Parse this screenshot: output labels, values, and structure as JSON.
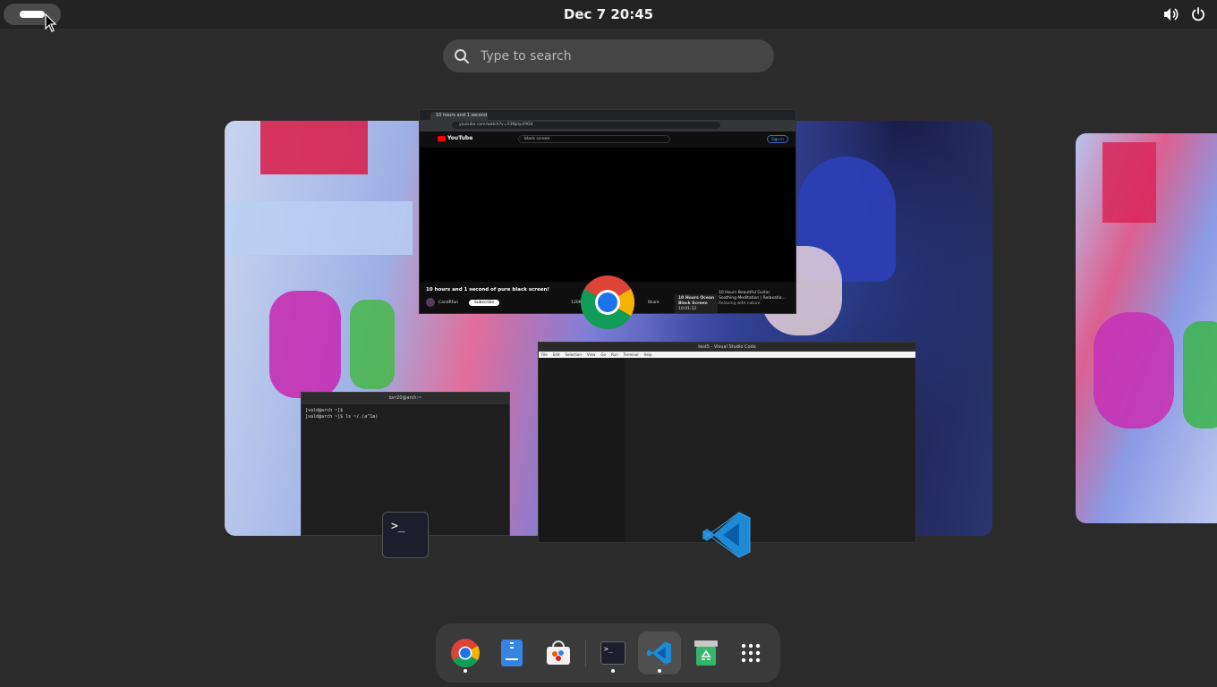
{
  "topbar": {
    "activities_label": "Activities",
    "clock": "Dec 7  20:45",
    "tray": [
      "volume-icon",
      "power-icon"
    ]
  },
  "search": {
    "placeholder": "Type to search"
  },
  "windows": {
    "chrome": {
      "tab_title": "10 hours and 1 second of",
      "url": "youtube.com/watch?v=X3NplycPIO4",
      "yt_logo": "YouTube",
      "yt_search": "black screen",
      "yt_signin": "Sign in",
      "video_title": "10 hours and 1 second of pure black screen!",
      "channel": "CandRfun",
      "subscribe": "Subscribe",
      "likes": "120K",
      "share": "Share",
      "rec1_line1": "10 Hours Ocean",
      "rec1_line2": "Black Screen",
      "rec1_time": "10:01:12",
      "rec2_line1": "10 Hours Beautiful Guitar",
      "rec2_line2": "Soothing Meditation | Relaxatio...",
      "rec2_line3": "Relaxing with nature"
    },
    "terminal": {
      "title": "lorr20@arch:~",
      "line1": "[vald@arch ~]$",
      "line2": "[vald@arch ~]$ ls ~/.(a^1a)"
    },
    "vscode": {
      "title": "test5 - Visual Studio Code",
      "menu": [
        "File",
        "Edit",
        "Selection",
        "View",
        "Go",
        "Run",
        "Terminal",
        "Help"
      ]
    }
  },
  "dash": {
    "items": [
      {
        "name": "Google Chrome",
        "icon": "chrome-icon",
        "running": true
      },
      {
        "name": "Text Editor",
        "icon": "text-editor-icon",
        "running": false
      },
      {
        "name": "Software",
        "icon": "software-icon",
        "running": false
      },
      {
        "name": "Terminal",
        "icon": "terminal-icon",
        "running": true
      },
      {
        "name": "Visual Studio Code",
        "icon": "vscode-icon",
        "running": true,
        "active": true
      },
      {
        "name": "Trash",
        "icon": "trash-icon",
        "running": false
      },
      {
        "name": "Show Apps",
        "icon": "app-grid-icon",
        "running": false
      }
    ]
  },
  "colors": {
    "panel": "#232323",
    "background": "#2b2b2b",
    "dash": "#3a3a3a",
    "search": "#454545",
    "accent_blue": "#1e8ad6"
  }
}
